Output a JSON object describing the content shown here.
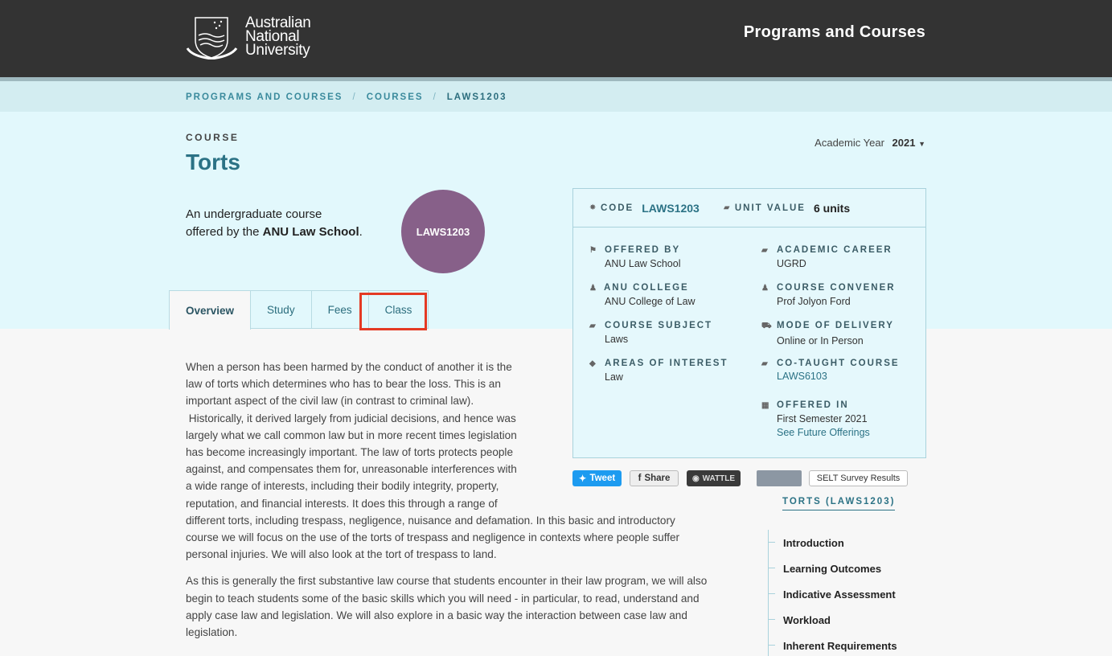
{
  "header": {
    "logo_lines": [
      "Australian",
      "National",
      "University"
    ],
    "title": "Programs and Courses"
  },
  "breadcrumb": [
    "PROGRAMS AND COURSES",
    "COURSES",
    "LAWS1203"
  ],
  "course": {
    "label": "COURSE",
    "title": "Torts",
    "intro_prefix": "An undergraduate course offered by the ",
    "school": "ANU Law School",
    "intro_suffix": ".",
    "code_badge": "LAWS1203"
  },
  "academic_year": {
    "label": "Academic Year",
    "value": "2021"
  },
  "tabs": [
    "Overview",
    "Study",
    "Fees",
    "Class"
  ],
  "panel": {
    "code_label": "CODE",
    "code_value": "LAWS1203",
    "unit_label": "UNIT VALUE",
    "unit_value": "6 units",
    "fields": {
      "offered_by": {
        "label": "OFFERED BY",
        "value": "ANU Law School"
      },
      "academic_career": {
        "label": "ACADEMIC CAREER",
        "value": "UGRD"
      },
      "college": {
        "label": "ANU COLLEGE",
        "value": "ANU College of Law"
      },
      "convener": {
        "label": "COURSE CONVENER",
        "value": "Prof Jolyon Ford"
      },
      "subject": {
        "label": "COURSE SUBJECT",
        "value": "Laws"
      },
      "delivery": {
        "label": "MODE OF DELIVERY",
        "value": "Online or In Person"
      },
      "interest": {
        "label": "AREAS OF INTEREST",
        "value": "Law"
      },
      "cotaught": {
        "label": "CO-TAUGHT COURSE",
        "value": "LAWS6103"
      },
      "offered_in": {
        "label": "OFFERED IN",
        "value": "First Semester 2021",
        "link": "See Future Offerings"
      }
    }
  },
  "social": {
    "tweet": "Tweet",
    "share": "Share",
    "wattle": "WATTLE",
    "selt": "SELT Survey Results"
  },
  "toc": {
    "title": "TORTS (LAWS1203)",
    "items": [
      "Introduction",
      "Learning Outcomes",
      "Indicative Assessment",
      "Workload",
      "Inherent Requirements"
    ]
  },
  "body": {
    "p1_lines_narrow": [
      "When a person has been harmed by the conduct of another it is the",
      "law of torts which determines who has to bear the loss.   This is an",
      "important aspect of the civil law (in contrast to criminal law).",
      " Historically, it derived largely from judicial decisions, and hence was",
      "largely what we call common law but in more recent times legislation",
      "has become increasingly important.  The law of torts protects people",
      "against, and compensates them for, unreasonable interferences with",
      "a wide range of interests, including their bodily integrity, property,",
      "reputation, and financial interests.  It does this through a range of"
    ],
    "p1_lines_wide": [
      "different torts, including trespass, negligence, nuisance and defamation.  In this basic and introductory",
      "course we will focus on the use of the torts of trespass and negligence in contexts where people suffer",
      "personal injuries.  We will also look at the tort of trespass to land."
    ],
    "p2_lines": [
      "As this is generally the first substantive law course that students encounter in their law program, we will also",
      "begin to teach students some of the basic skills which you will need - in particular, to read, understand and",
      "apply case law and legislation.  We will also explore in a basic way the interaction between case law and",
      "legislation."
    ]
  },
  "colors": {
    "header_bg": "#333333",
    "accent": "#2b7285",
    "badge": "#876089",
    "highlight": "#e43a24"
  }
}
